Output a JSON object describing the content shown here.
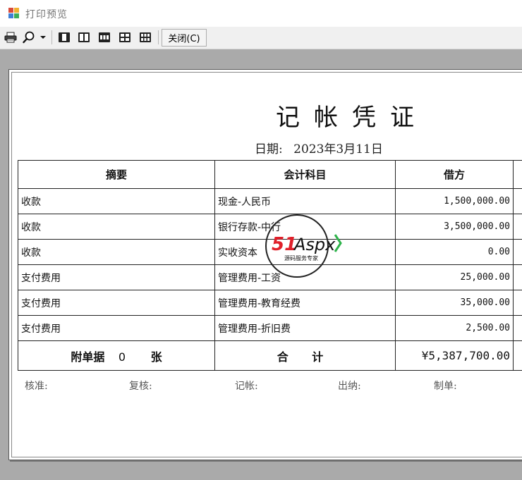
{
  "window": {
    "title": "打印预览"
  },
  "toolbar": {
    "print_icon": "printer-icon",
    "zoom_icon": "magnifier-icon",
    "zoom_dropdown_icon": "chevron-down-icon",
    "layout_buttons": [
      "one-page-icon",
      "two-pages-icon",
      "three-pages-icon",
      "four-pages-icon",
      "six-pages-icon"
    ],
    "close_label": "关闭(C)"
  },
  "document": {
    "title": "记帐凭证",
    "date_label": "日期:",
    "date_value": "2023年3月11日",
    "columns": [
      "摘要",
      "会计科目",
      "借方"
    ],
    "rows": [
      {
        "summary": "收款",
        "account": "现金-人民币",
        "debit": "1,500,000.00"
      },
      {
        "summary": "收款",
        "account": "银行存款-中行",
        "debit": "3,500,000.00"
      },
      {
        "summary": "收款",
        "account": "实收资本",
        "debit": "0.00"
      },
      {
        "summary": "支付费用",
        "account": "管理费用-工资",
        "debit": "25,000.00"
      },
      {
        "summary": "支付费用",
        "account": "管理费用-教育经费",
        "debit": "35,000.00"
      },
      {
        "summary": "支付费用",
        "account": "管理费用-折旧费",
        "debit": "2,500.00"
      }
    ],
    "footer": {
      "attach_label": "附单据",
      "attach_count": "0",
      "attach_unit": "张",
      "total_label": "合 计",
      "total_debit": "¥5,387,700.00"
    },
    "signatures": [
      "核准:",
      "复核:",
      "记帐:",
      "出纳:",
      "制单:"
    ]
  },
  "watermark": {
    "brand": "51Aspx",
    "tagline": "源码服务专家"
  },
  "colors": {
    "preview_bg": "#aaaaaa",
    "toolbar_bg": "#f0f0f0",
    "watermark_red": "#e0202a",
    "watermark_green": "#2db34a"
  }
}
